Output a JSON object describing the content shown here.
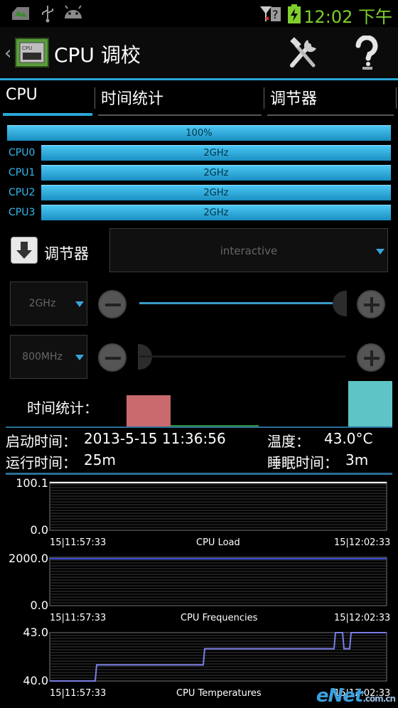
{
  "statusbar": {
    "time": "12:02 下午"
  },
  "actionbar": {
    "title": "CPU 调校",
    "back_glyph": "‹"
  },
  "tabs": [
    {
      "label": "CPU",
      "active": true
    },
    {
      "label": "时间统计",
      "active": false
    },
    {
      "label": "调节器",
      "active": false
    }
  ],
  "cpu": {
    "total": "100%",
    "cores": [
      {
        "name": "CPU0",
        "freq": "2GHz"
      },
      {
        "name": "CPU1",
        "freq": "2GHz"
      },
      {
        "name": "CPU2",
        "freq": "2GHz"
      },
      {
        "name": "CPU3",
        "freq": "2GHz"
      }
    ]
  },
  "governor": {
    "label": "调节器",
    "value": "interactive"
  },
  "max_freq": {
    "value": "2GHz",
    "level": 1.0
  },
  "min_freq": {
    "value": "800MHz",
    "level": 0.0
  },
  "time_stats": {
    "label": "时间统计：",
    "bars": [
      {
        "color": "#c86a6e",
        "share": 0.18
      },
      {
        "color": "#2f8f3f",
        "share": 0.01
      },
      {
        "color": "#5ec4c6",
        "share": 0.26
      }
    ]
  },
  "info": {
    "boot_label": "启动时间：",
    "boot_value": "2013-5-15 11:36:56",
    "temp_label": "温度：",
    "temp_value": "43.0°C",
    "uptime_label": "运行时间：",
    "uptime_value": "25m",
    "sleep_label": "睡眠时间：",
    "sleep_value": "3m"
  },
  "graphs": [
    {
      "title": "CPU Load",
      "ymax": "100.1",
      "ymin": "0.0",
      "xstart": "15|11:57:33",
      "xend": "15|12:02:33",
      "line_color": "#ffffff"
    },
    {
      "title": "CPU Frequencies",
      "ymax": "2000.0",
      "ymin": "0.0",
      "xstart": "15|11:57:33",
      "xend": "15|12:02:33",
      "line_color": "#3a4adb"
    },
    {
      "title": "CPU Temperatures",
      "ymax": "43.0",
      "ymin": "40.0",
      "xstart": "15|11:57:33",
      "xend": "15|12:02:33",
      "line_color": "#7b7ee8"
    }
  ],
  "watermark": {
    "brand": "eNet",
    "domain": ".com.cn"
  },
  "colors": {
    "accent": "#2aa6d8",
    "clock": "#7fcf2f"
  }
}
